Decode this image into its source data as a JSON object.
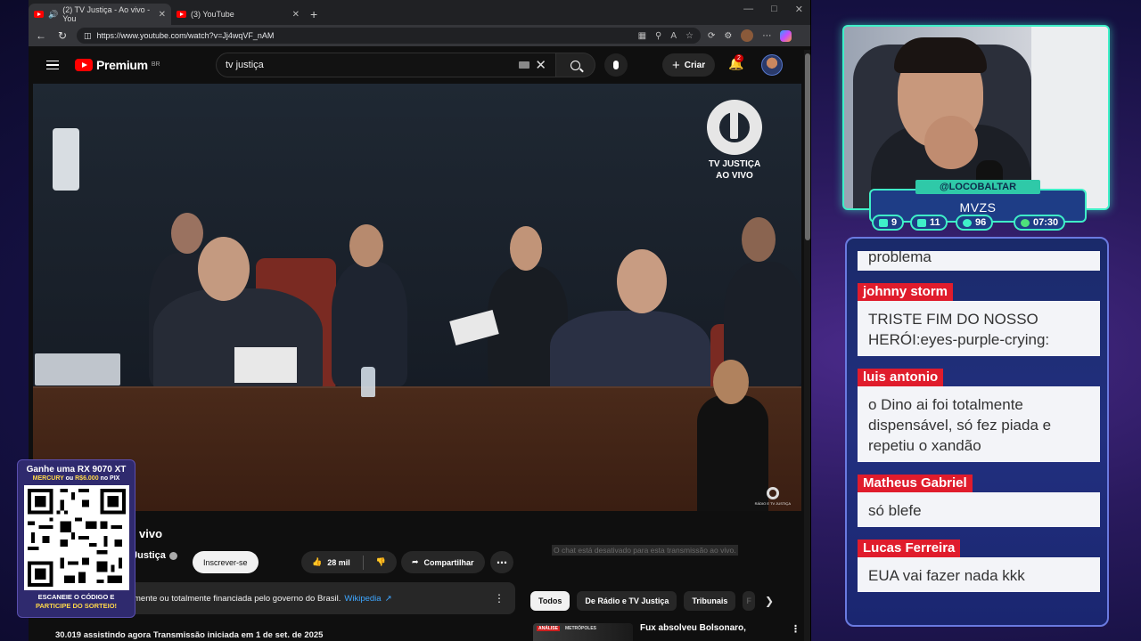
{
  "browser": {
    "tabs": [
      {
        "label": "(2) TV Justiça - Ao vivo - You",
        "active": true
      },
      {
        "label": "(3) YouTube",
        "active": false
      }
    ],
    "url": "https://www.youtube.com/watch?v=Jj4wqVF_nAM"
  },
  "youtube": {
    "logo_text": "Premium",
    "country": "BR",
    "search_value": "tv justiça",
    "create_label": "Criar",
    "notification_count": "2",
    "video": {
      "overlay_logo_line1": "TV JUSTIÇA",
      "overlay_logo_line2": "AO VIVO",
      "small_logo_text": "RÁDIO E TV JUSTIÇA"
    },
    "title": "vivo",
    "channel": "Justiça",
    "subscribe_label": "Inscrever-se",
    "likes": "28 mil",
    "share_label": "Compartilhar",
    "info_text": "mente ou totalmente financiada pelo governo do Brasil.",
    "info_link": "Wikipedia",
    "stats_line": "30.019 assistindo agora  Transmissão iniciada em 1 de set. de 2025",
    "chat_disabled": "O chat está desativado para esta transmissão ao vivo.",
    "chips": [
      "Todos",
      "De Rádio e TV Justiça",
      "Tribunais",
      "F"
    ],
    "rec": {
      "badge": "ANÁLISE",
      "source": "METRÓPOLES",
      "title": "Fux absolveu Bolsonaro,"
    }
  },
  "qr_promo": {
    "title": "Ganhe uma RX 9070 XT",
    "sub_part1": "MERCURY",
    "sub_part2": " ou ",
    "sub_part3": "R$6.000",
    "sub_part4": " no PIX",
    "foot_line1": "ESCANEIE O CÓDIGO E",
    "foot_line2": "PARTICIPE DO SORTEIO!"
  },
  "streamer": {
    "handle": "@LOCOBALTAR",
    "name": "MVZS",
    "stats": [
      {
        "icon": "chat-icon",
        "value": "9"
      },
      {
        "icon": "youtube-icon",
        "value": "11"
      },
      {
        "icon": "kick-icon",
        "value": "96"
      },
      {
        "icon": "whatsapp-icon",
        "value": "07:30"
      }
    ],
    "accent": "#3ff0c8"
  },
  "chat": {
    "partial": "problema",
    "messages": [
      {
        "user": "johnny storm",
        "text": "TRISTE FIM DO NOSSO HERÓI:eyes-purple-crying:"
      },
      {
        "user": "luis antonio",
        "text": "o Dino ai foi totalmente dispensável, só fez piada e repetiu o xandão"
      },
      {
        "user": "Matheus Gabriel",
        "text": "só blefe"
      },
      {
        "user": "Lucas Ferreira",
        "text": "EUA vai fazer nada kkk"
      }
    ]
  }
}
